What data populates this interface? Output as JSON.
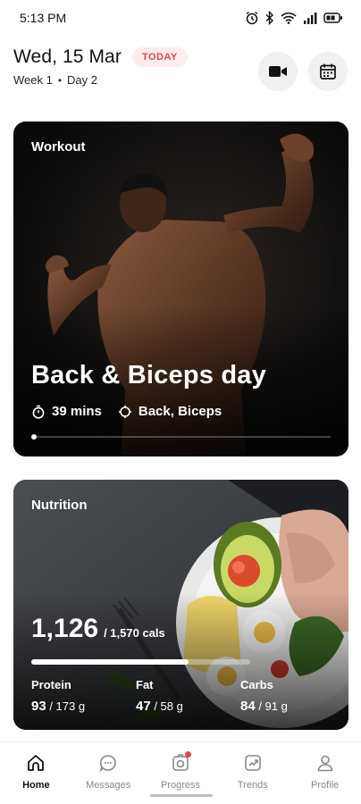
{
  "status_bar": {
    "time": "5:13 PM",
    "icons": [
      "alarm-icon",
      "bluetooth-icon",
      "wifi-icon",
      "signal-icon",
      "battery-icon"
    ]
  },
  "header": {
    "date": "Wed, 15 Mar",
    "today_badge": "TODAY",
    "week": "Week 1",
    "day": "Day 2",
    "actions": [
      "video-camera-icon",
      "calendar-icon"
    ]
  },
  "workout": {
    "label": "Workout",
    "title": "Back & Biceps day",
    "duration": "39 mins",
    "muscles": "Back, Biceps",
    "progress": 0.01
  },
  "nutrition": {
    "label": "Nutrition",
    "calories": "1,126",
    "calories_goal": "/ 1,570 cals",
    "progress": 0.717,
    "macros": [
      {
        "name": "Protein",
        "value": "93",
        "goal": "/ 173 g"
      },
      {
        "name": "Fat",
        "value": "47",
        "goal": "/ 58 g"
      },
      {
        "name": "Carbs",
        "value": "84",
        "goal": "/ 91 g"
      }
    ]
  },
  "nav": {
    "items": [
      {
        "label": "Home",
        "icon": "home-icon",
        "active": true
      },
      {
        "label": "Messages",
        "icon": "chat-icon",
        "active": false
      },
      {
        "label": "Progress",
        "icon": "camera-icon",
        "active": false,
        "badge": true
      },
      {
        "label": "Trends",
        "icon": "trend-icon",
        "active": false
      },
      {
        "label": "Profile",
        "icon": "person-icon",
        "active": false
      }
    ]
  },
  "colors": {
    "accent": "#e2474b",
    "badge_bg": "#fdecec"
  }
}
